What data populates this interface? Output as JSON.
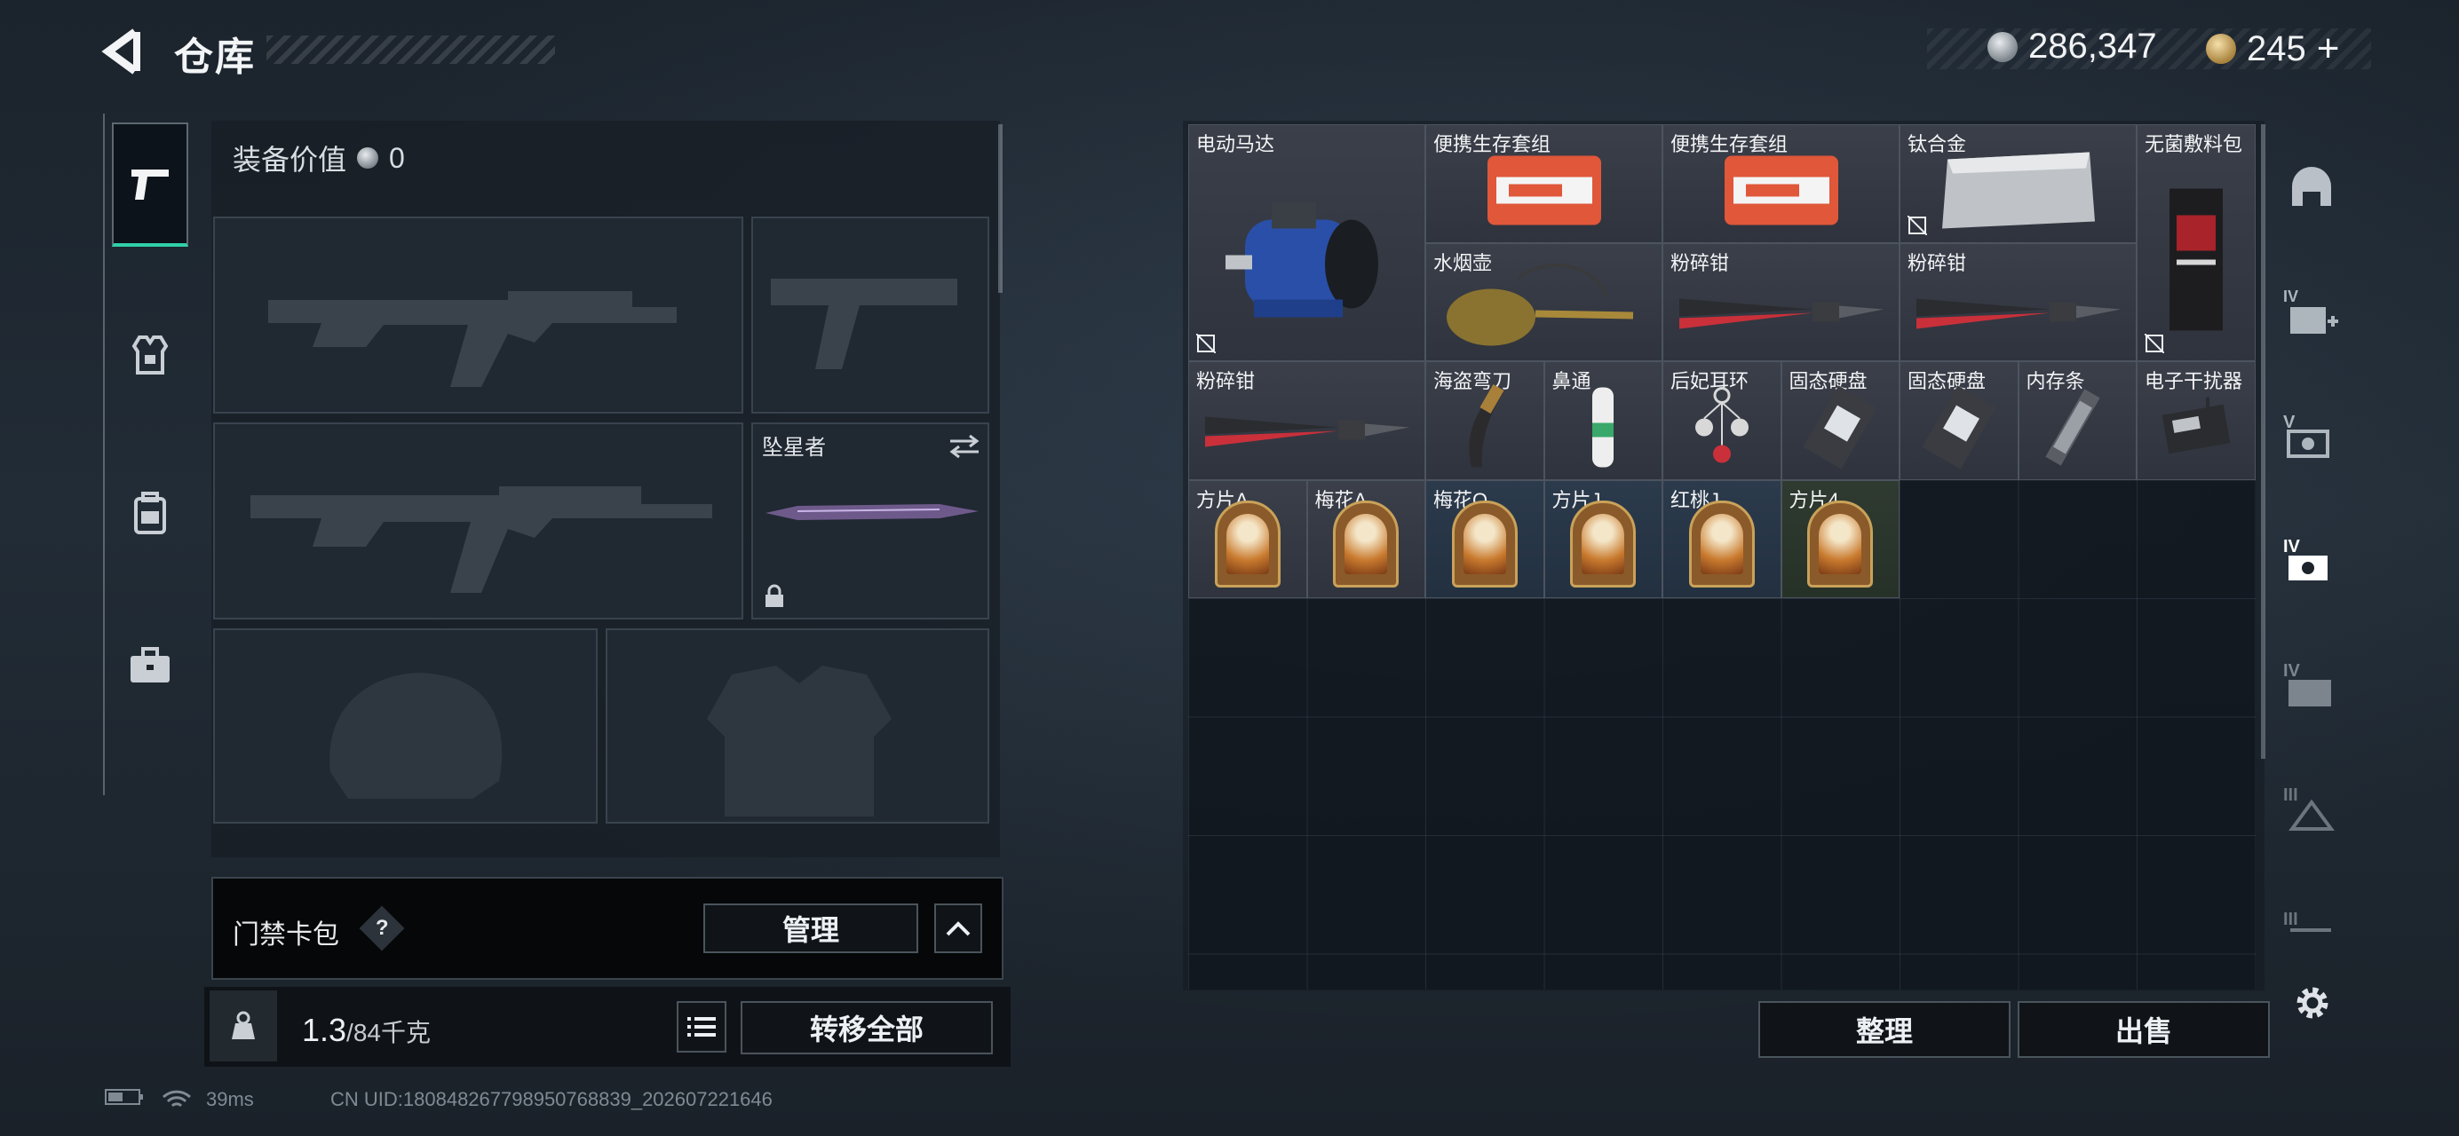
{
  "header": {
    "title": "仓库",
    "currency": [
      {
        "icon": "silver-coin-icon",
        "value": "286,347"
      },
      {
        "icon": "gold-coin-icon",
        "value": "245"
      }
    ],
    "add_label": "+"
  },
  "sidebar": {
    "tabs": [
      {
        "name": "weapons",
        "icon": "pistol-icon",
        "active": true
      },
      {
        "name": "armor",
        "icon": "vest-icon",
        "active": false
      },
      {
        "name": "backpack",
        "icon": "backpack-icon",
        "active": false
      },
      {
        "name": "case",
        "icon": "briefcase-icon",
        "active": false
      }
    ]
  },
  "loadout": {
    "equip_value_label": "装备价值",
    "equip_value": "0",
    "melee_name": "坠星者",
    "card_pack_label": "门禁卡包",
    "help_label": "?",
    "manage_label": "管理",
    "weight_value": "1.3",
    "weight_capacity": "/84千克",
    "transfer_all_label": "转移全部"
  },
  "warehouse": {
    "items": [
      {
        "label": "电动马达",
        "bg": "gray",
        "icon": "motor-icon",
        "nocut": true
      },
      {
        "label": "便携生存套组",
        "bg": "gray",
        "icon": "survival-kit-icon"
      },
      {
        "label": "便携生存套组",
        "bg": "gray",
        "icon": "survival-kit-icon"
      },
      {
        "label": "钛合金",
        "bg": "gray",
        "icon": "titanium-ingot-icon",
        "nocut": true
      },
      {
        "label": "无菌敷料包",
        "bg": "gray",
        "icon": "dressing-pack-icon",
        "nocut": true
      },
      {
        "label": "水烟壶",
        "bg": "gray",
        "icon": "hookah-icon"
      },
      {
        "label": "粉碎钳",
        "bg": "gray",
        "icon": "bolt-cutter-icon"
      },
      {
        "label": "粉碎钳",
        "bg": "gray",
        "icon": "bolt-cutter-icon"
      },
      {
        "label": "粉碎钳",
        "bg": "gray",
        "icon": "bolt-cutter-icon"
      },
      {
        "label": "海盗弯刀",
        "bg": "gray",
        "icon": "knife-icon"
      },
      {
        "label": "鼻通",
        "bg": "gray",
        "icon": "inhaler-icon"
      },
      {
        "label": "后妃耳环",
        "bg": "gray",
        "icon": "earring-icon"
      },
      {
        "label": "固态硬盘",
        "bg": "gray",
        "icon": "ssd-icon"
      },
      {
        "label": "固态硬盘",
        "bg": "gray",
        "icon": "ssd-icon"
      },
      {
        "label": "内存条",
        "bg": "gray",
        "icon": "ram-icon"
      },
      {
        "label": "电子干扰器",
        "bg": "gray",
        "icon": "jammer-icon"
      },
      {
        "label": "方片A",
        "bg": "gray",
        "icon": "card-icon"
      },
      {
        "label": "梅花A",
        "bg": "gray",
        "icon": "card-icon"
      },
      {
        "label": "梅花Q",
        "bg": "blue",
        "icon": "card-icon"
      },
      {
        "label": "方片J",
        "bg": "blue",
        "icon": "card-icon"
      },
      {
        "label": "红桃J",
        "bg": "blue",
        "icon": "card-icon"
      },
      {
        "label": "方片4",
        "bg": "green",
        "icon": "card-icon"
      }
    ],
    "tidy_label": "整理",
    "sell_label": "出售"
  },
  "right_rail": [
    {
      "icon": "helmet-slot-icon",
      "roman": ""
    },
    {
      "icon": "add-armor-icon",
      "roman": "IV"
    },
    {
      "icon": "armor-v-icon",
      "roman": "V"
    },
    {
      "icon": "armor-iv-icon",
      "roman": "IV"
    },
    {
      "icon": "folder-iv-icon",
      "roman": "IV"
    },
    {
      "icon": "triangle-iii-icon",
      "roman": "III"
    },
    {
      "icon": "iii-icon",
      "roman": "III"
    },
    {
      "icon": "gear-icon",
      "roman": ""
    }
  ],
  "status": {
    "ping": "39ms",
    "uid": "CN UID:180848267798950768839_202607221646"
  }
}
